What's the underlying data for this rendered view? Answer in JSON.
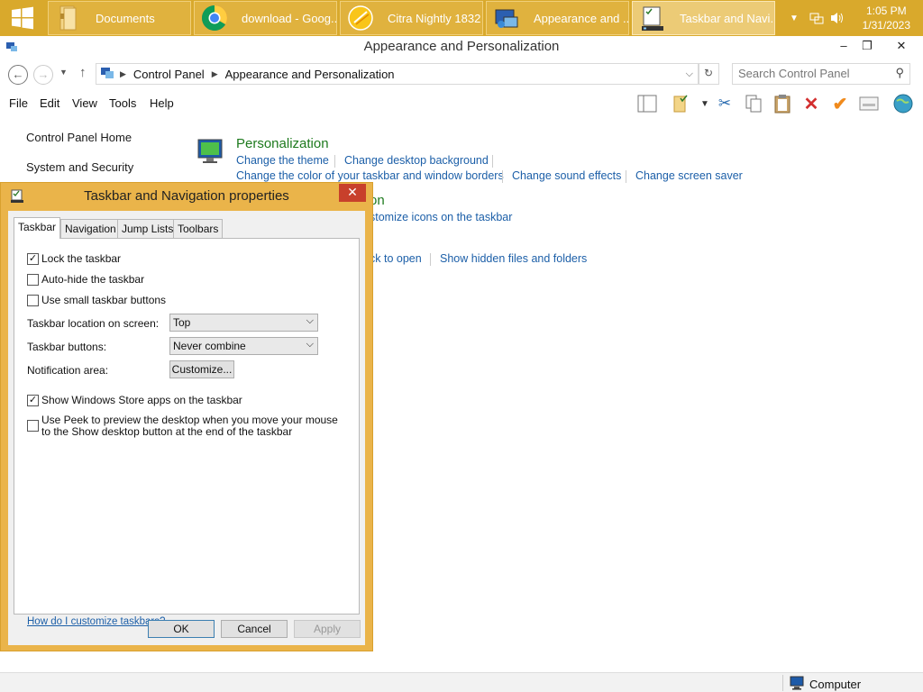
{
  "taskbar": {
    "buttons": [
      {
        "label": "Documents",
        "icon": "folder-icon"
      },
      {
        "label": "download - Goog...",
        "icon": "chrome-icon"
      },
      {
        "label": "Citra Nightly 1832",
        "icon": "citra-icon"
      },
      {
        "label": "Appearance and ...",
        "icon": "control-panel-icon"
      },
      {
        "label": "Taskbar and Navi...",
        "icon": "taskbar-properties-icon"
      }
    ],
    "clock": {
      "time": "1:05 PM",
      "date": "1/31/2023"
    },
    "colors": {
      "background": "#d9a92c",
      "button": "#e0b23e"
    }
  },
  "window": {
    "title": "Appearance and Personalization",
    "address": {
      "root": "Control Panel",
      "current": "Appearance and Personalization"
    },
    "search_placeholder": "Search Control Panel",
    "menu": [
      "File",
      "Edit",
      "View",
      "Tools",
      "Help"
    ]
  },
  "sidebar": {
    "items": [
      "Control Panel Home",
      "System and Security"
    ]
  },
  "content": {
    "personalization": {
      "title": "Personalization",
      "links": [
        "Change the theme",
        "Change desktop background",
        "Change the color of your taskbar and window borders",
        "Change sound effects",
        "Change screen saver"
      ]
    },
    "taskbar_nav_fragments": {
      "title_tail": "on",
      "link": "stomize icons on the taskbar"
    },
    "folder_options_fragments": {
      "link_tail": "ck to open",
      "link": "Show hidden files and folders"
    }
  },
  "dialog": {
    "title": "Taskbar and Navigation properties",
    "close": "✕",
    "tabs": [
      "Taskbar",
      "Navigation",
      "Jump Lists",
      "Toolbars"
    ],
    "options": {
      "lock": {
        "label": "Lock the taskbar",
        "checked": true
      },
      "autohide": {
        "label": "Auto-hide the taskbar",
        "checked": false
      },
      "small_buttons": {
        "label": "Use small taskbar buttons",
        "checked": false
      },
      "store_apps": {
        "label": "Show Windows Store apps on the taskbar",
        "checked": true
      },
      "peek": {
        "label": "Use Peek to preview the desktop when you move your mouse to the Show desktop button at the end of the taskbar",
        "checked": false
      }
    },
    "location": {
      "label": "Taskbar location on screen:",
      "value": "Top"
    },
    "buttons_combine": {
      "label": "Taskbar buttons:",
      "value": "Never combine"
    },
    "notification": {
      "label": "Notification area:",
      "button": "Customize..."
    },
    "help_link": "How do I customize taskbars?",
    "footer": {
      "ok": "OK",
      "cancel": "Cancel",
      "apply": "Apply"
    }
  },
  "statusbar": {
    "location": "Computer"
  }
}
